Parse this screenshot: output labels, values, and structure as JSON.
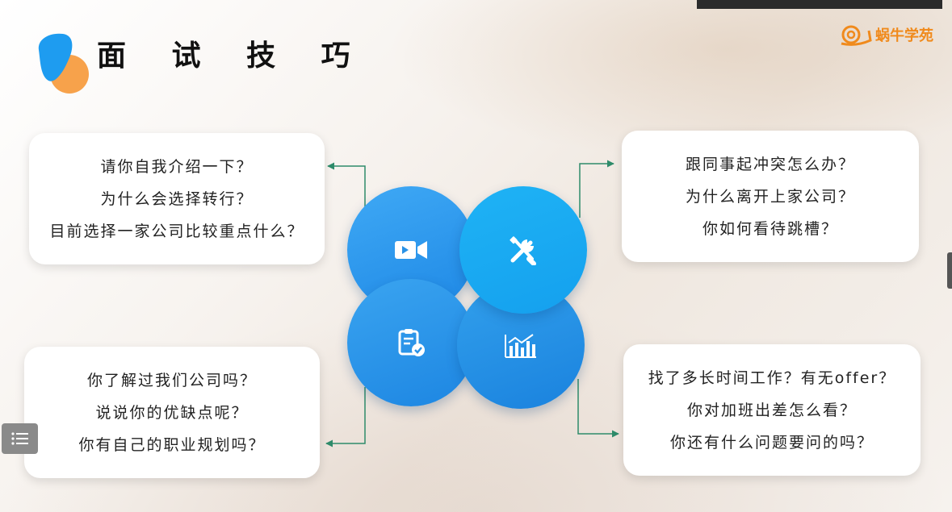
{
  "slide": {
    "title": "面 试 技 巧",
    "brand": "蜗牛学苑"
  },
  "cards": {
    "top_left": [
      "请你自我介绍一下？",
      "为什么会选择转行？",
      "目前选择一家公司比较重点什么？"
    ],
    "top_right": [
      "跟同事起冲突怎么办？",
      "为什么离开上家公司？",
      "你如何看待跳槽？"
    ],
    "bottom_left": [
      "你了解过我们公司吗？",
      "说说你的优缺点呢？",
      "你有自己的职业规划吗？"
    ],
    "bottom_right": [
      "找了多长时间工作？有无offer？",
      "你对加班出差怎么看？",
      "你还有什么问题要问的吗？"
    ]
  },
  "icons": {
    "circle_top_left": "video-camera-icon",
    "circle_top_right": "tools-icon",
    "circle_bottom_left": "clipboard-check-icon",
    "circle_bottom_right": "bar-chart-icon",
    "menu": "list-menu-icon"
  },
  "colors": {
    "connector": "#2e8b6a",
    "circle_blue": "#1e88e5",
    "circle_cyan": "#14a8f0",
    "logo_blue": "#1e9cf0",
    "logo_orange": "#f7a24b",
    "brand": "#f08a1c"
  }
}
